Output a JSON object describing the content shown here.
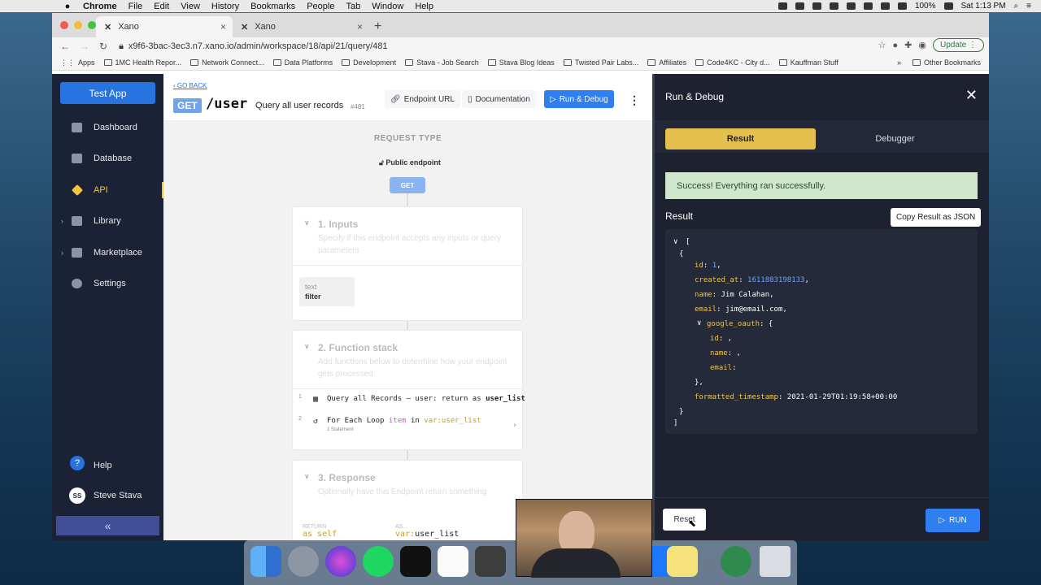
{
  "menubar": {
    "app": "Chrome",
    "items": [
      "File",
      "Edit",
      "View",
      "History",
      "Bookmarks",
      "People",
      "Tab",
      "Window",
      "Help"
    ],
    "battery": "100%",
    "clock": "Sat 1:13 PM"
  },
  "browser": {
    "tabs": [
      {
        "title": "Xano"
      },
      {
        "title": "Xano"
      }
    ],
    "url": "x9f6-3bac-3ec3.n7.xano.io/admin/workspace/18/api/21/query/481",
    "update_label": "Update",
    "bookmarks": [
      "Apps",
      "1MC Health Repor...",
      "Network Connect...",
      "Data Platforms",
      "Development",
      "Stava - Job Search",
      "Stava Blog Ideas",
      "Twisted Pair Labs...",
      "Affiliates",
      "Code4KC - City d...",
      "Kauffman Stuff"
    ],
    "bookmarks_more": "»",
    "other_bookmarks": "Other Bookmarks"
  },
  "sidebar": {
    "app_name": "Test App",
    "items": [
      {
        "label": "Dashboard",
        "icon": "dashboard-icon"
      },
      {
        "label": "Database",
        "icon": "database-icon"
      },
      {
        "label": "API",
        "icon": "api-icon",
        "active": true
      },
      {
        "label": "Library",
        "icon": "library-icon"
      },
      {
        "label": "Marketplace",
        "icon": "marketplace-icon"
      },
      {
        "label": "Settings",
        "icon": "gear-icon"
      }
    ],
    "help": "Help",
    "user_initials": "SS",
    "user_name": "Steve Stava",
    "collapse": "«"
  },
  "endpoint": {
    "go_back": "GO BACK",
    "method": "GET",
    "path": "/user",
    "description": "Query all user records",
    "id": "#481",
    "endpoint_url": "Endpoint URL",
    "documentation": "Documentation",
    "run_debug": "Run & Debug",
    "request_type": "REQUEST TYPE",
    "public": "Public endpoint",
    "method_node": "GET"
  },
  "inputs": {
    "title": "1. Inputs",
    "desc": "Specify if this endpoint accepts any inputs or query parameters",
    "input_type": "text",
    "input_name": "filter"
  },
  "stack": {
    "title": "2. Function stack",
    "desc": "Add functions below to determine how your endpoint gets processed",
    "f1_num": "1",
    "f1_prefix": "Query all Records – user: return as ",
    "f1_bold": "user_list",
    "f2_num": "2",
    "f2_a": "For Each Loop ",
    "f2_item": "item",
    "f2_in": " in ",
    "f2_var": "var:",
    "f2_name": "user_list",
    "f2_sub": "1 Statement"
  },
  "response": {
    "title": "3. Response",
    "desc": "Optionally have this Endpoint return something",
    "return_lbl": "RETURN",
    "return_val": "as self",
    "as_lbl": "AS...",
    "as_var": "var:",
    "as_val": "user_list"
  },
  "panel": {
    "title": "Run & Debug",
    "tab_result": "Result",
    "tab_debugger": "Debugger",
    "success": "Success! Everything ran successfully.",
    "result_label": "Result",
    "copy": "Copy Result as JSON",
    "reset": "Reset",
    "run": "RUN",
    "json": {
      "open": "[",
      "obj_open": "{",
      "id_k": "id",
      "id_v": "1",
      "created_k": "created_at",
      "created_v": "1611883198133",
      "name_k": "name",
      "name_v": "Jim Calahan",
      "email_k": "email",
      "email_v": "jim@email.com",
      "oauth_k": "google_oauth",
      "oauth_open": "{",
      "gid_k": "id",
      "gname_k": "name",
      "gemail_k": "email",
      "oauth_close": "},",
      "ts_k": "formatted_timestamp",
      "ts_v": "2021-01-29T01:19:58+00:00",
      "obj_close": "}",
      "close": "]"
    }
  },
  "colors": {
    "accent": "#2f7ff0",
    "sidebar": "#1c2235",
    "active": "#f0c540",
    "success_bg": "#cfe7cc"
  }
}
